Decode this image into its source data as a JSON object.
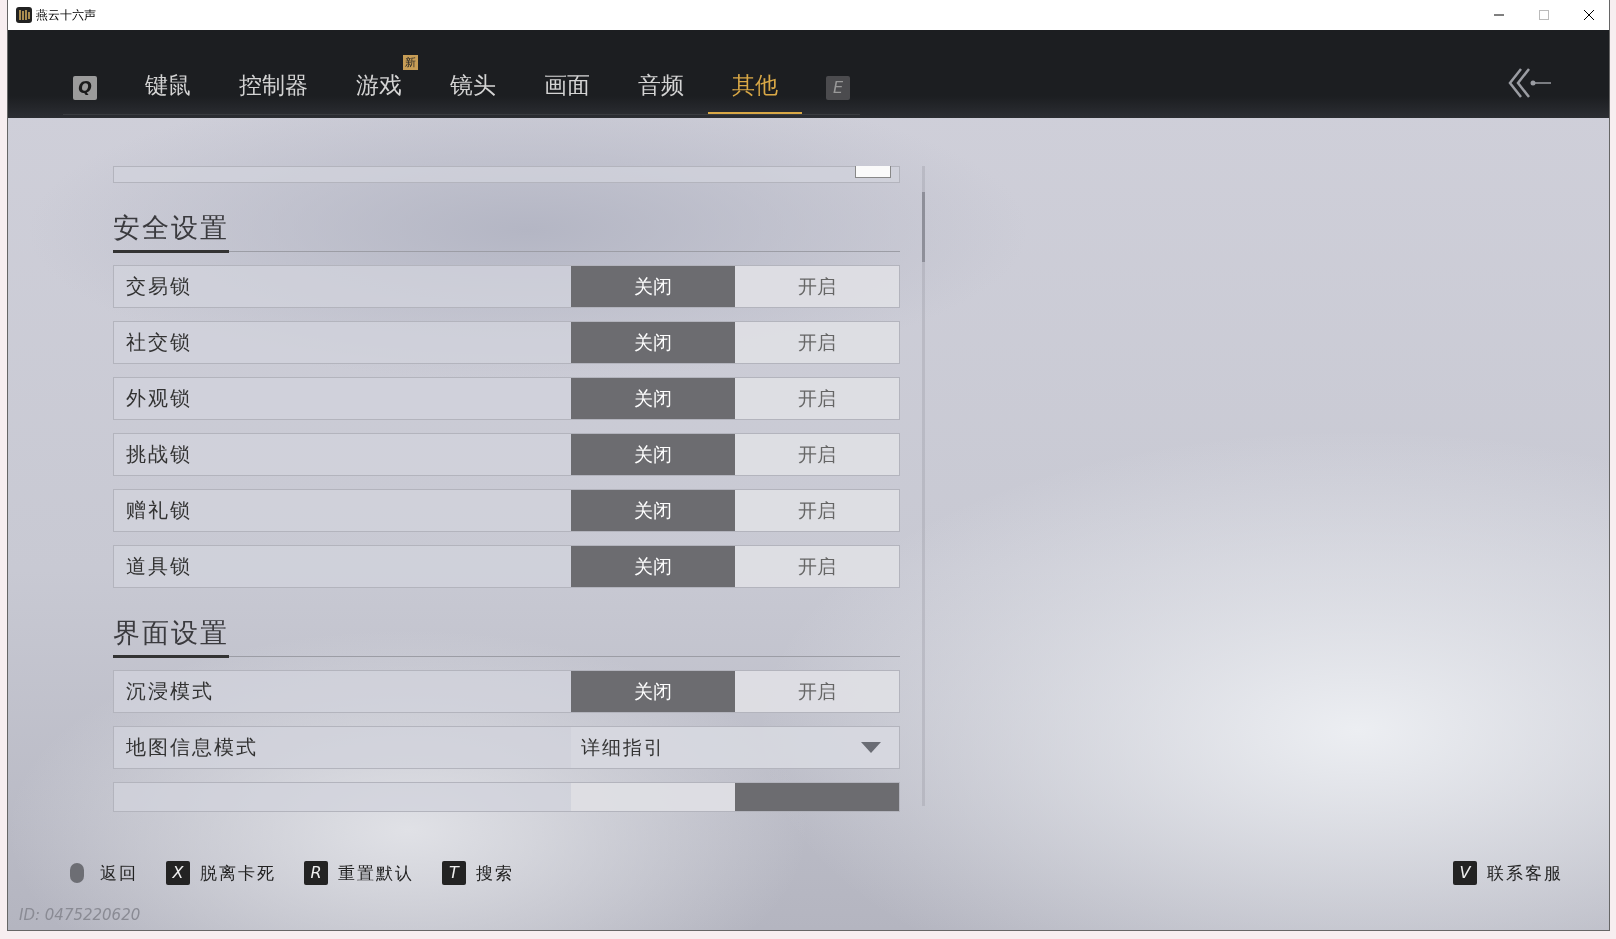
{
  "window": {
    "title": "燕云十六声"
  },
  "nav": {
    "prev_key": "Q",
    "next_key": "E",
    "tabs": [
      {
        "label": "键鼠",
        "selected": false
      },
      {
        "label": "控制器",
        "selected": false
      },
      {
        "label": "游戏",
        "selected": false,
        "badge": "新"
      },
      {
        "label": "镜头",
        "selected": false
      },
      {
        "label": "画面",
        "selected": false
      },
      {
        "label": "音频",
        "selected": false
      },
      {
        "label": "其他",
        "selected": true
      }
    ]
  },
  "settings": [
    {
      "kind": "cut_checkbox",
      "checked": false
    },
    {
      "kind": "heading",
      "label": "安全设置"
    },
    {
      "kind": "toggle",
      "label": "交易锁",
      "options": [
        {
          "label": "关闭",
          "selected": true
        },
        {
          "label": "开启",
          "selected": false
        }
      ]
    },
    {
      "kind": "toggle",
      "label": "社交锁",
      "options": [
        {
          "label": "关闭",
          "selected": true
        },
        {
          "label": "开启",
          "selected": false
        }
      ]
    },
    {
      "kind": "toggle",
      "label": "外观锁",
      "options": [
        {
          "label": "关闭",
          "selected": true
        },
        {
          "label": "开启",
          "selected": false
        }
      ]
    },
    {
      "kind": "toggle",
      "label": "挑战锁",
      "options": [
        {
          "label": "关闭",
          "selected": true
        },
        {
          "label": "开启",
          "selected": false
        }
      ]
    },
    {
      "kind": "toggle",
      "label": "赠礼锁",
      "options": [
        {
          "label": "关闭",
          "selected": true
        },
        {
          "label": "开启",
          "selected": false
        }
      ]
    },
    {
      "kind": "toggle",
      "label": "道具锁",
      "options": [
        {
          "label": "关闭",
          "selected": true
        },
        {
          "label": "开启",
          "selected": false
        }
      ]
    },
    {
      "kind": "heading",
      "label": "界面设置"
    },
    {
      "kind": "toggle",
      "label": "沉浸模式",
      "options": [
        {
          "label": "关闭",
          "selected": true
        },
        {
          "label": "开启",
          "selected": false
        }
      ]
    },
    {
      "kind": "dropdown",
      "label": "地图信息模式",
      "value": "详细指引"
    },
    {
      "kind": "cut_toggle",
      "options": [
        {
          "selected": false
        },
        {
          "selected": true
        }
      ]
    }
  ],
  "hints": [
    {
      "kind": "mouse",
      "label": "返回"
    },
    {
      "kind": "key",
      "key": "X",
      "label": "脱离卡死"
    },
    {
      "kind": "key",
      "key": "R",
      "label": "重置默认"
    },
    {
      "kind": "key",
      "key": "T",
      "label": "搜索"
    }
  ],
  "support": {
    "key": "V",
    "label": "联系客服"
  },
  "user_id": "ID: 0475220620"
}
